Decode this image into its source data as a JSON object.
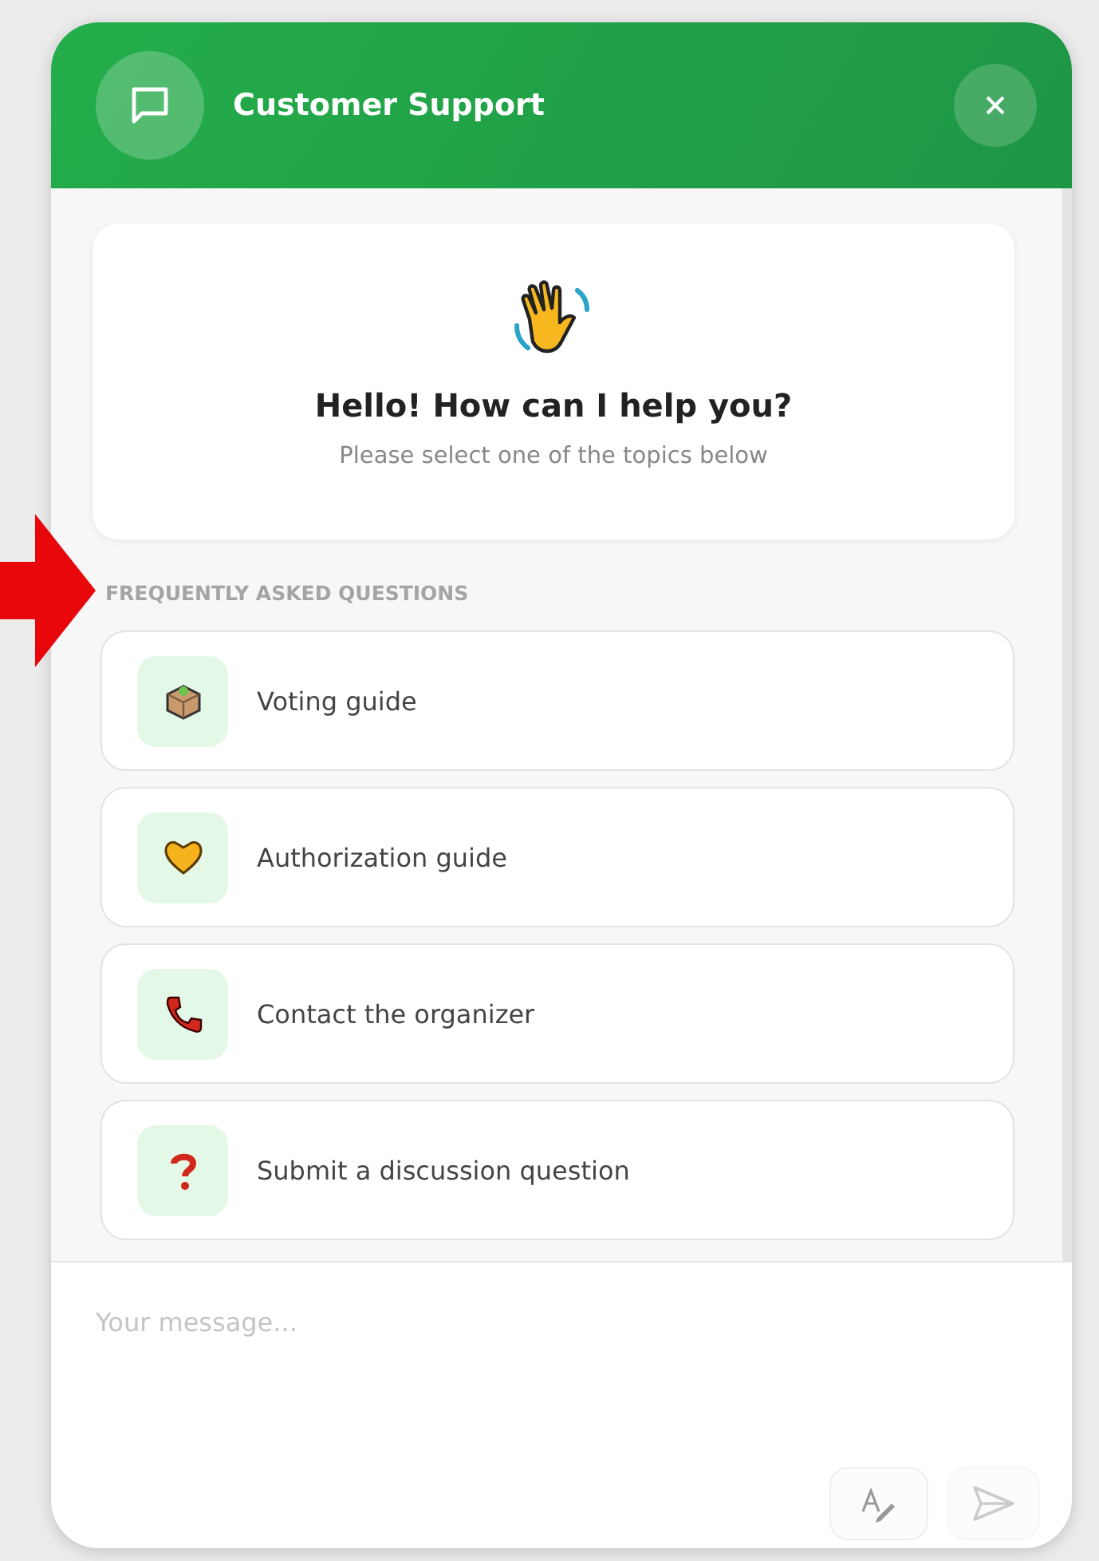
{
  "header": {
    "title": "Customer Support"
  },
  "greeting": {
    "title": "Hello! How can I help you?",
    "subtitle": "Please select one of the topics below"
  },
  "faq": {
    "heading": "FREQUENTLY ASKED QUESTIONS",
    "items": [
      {
        "kind": "ballot",
        "label": "Voting guide"
      },
      {
        "kind": "heart",
        "label": "Authorization guide"
      },
      {
        "kind": "phone",
        "label": "Contact the organizer"
      },
      {
        "kind": "question",
        "label": "Submit a discussion question"
      }
    ]
  },
  "composer": {
    "placeholder": "Your message..."
  }
}
